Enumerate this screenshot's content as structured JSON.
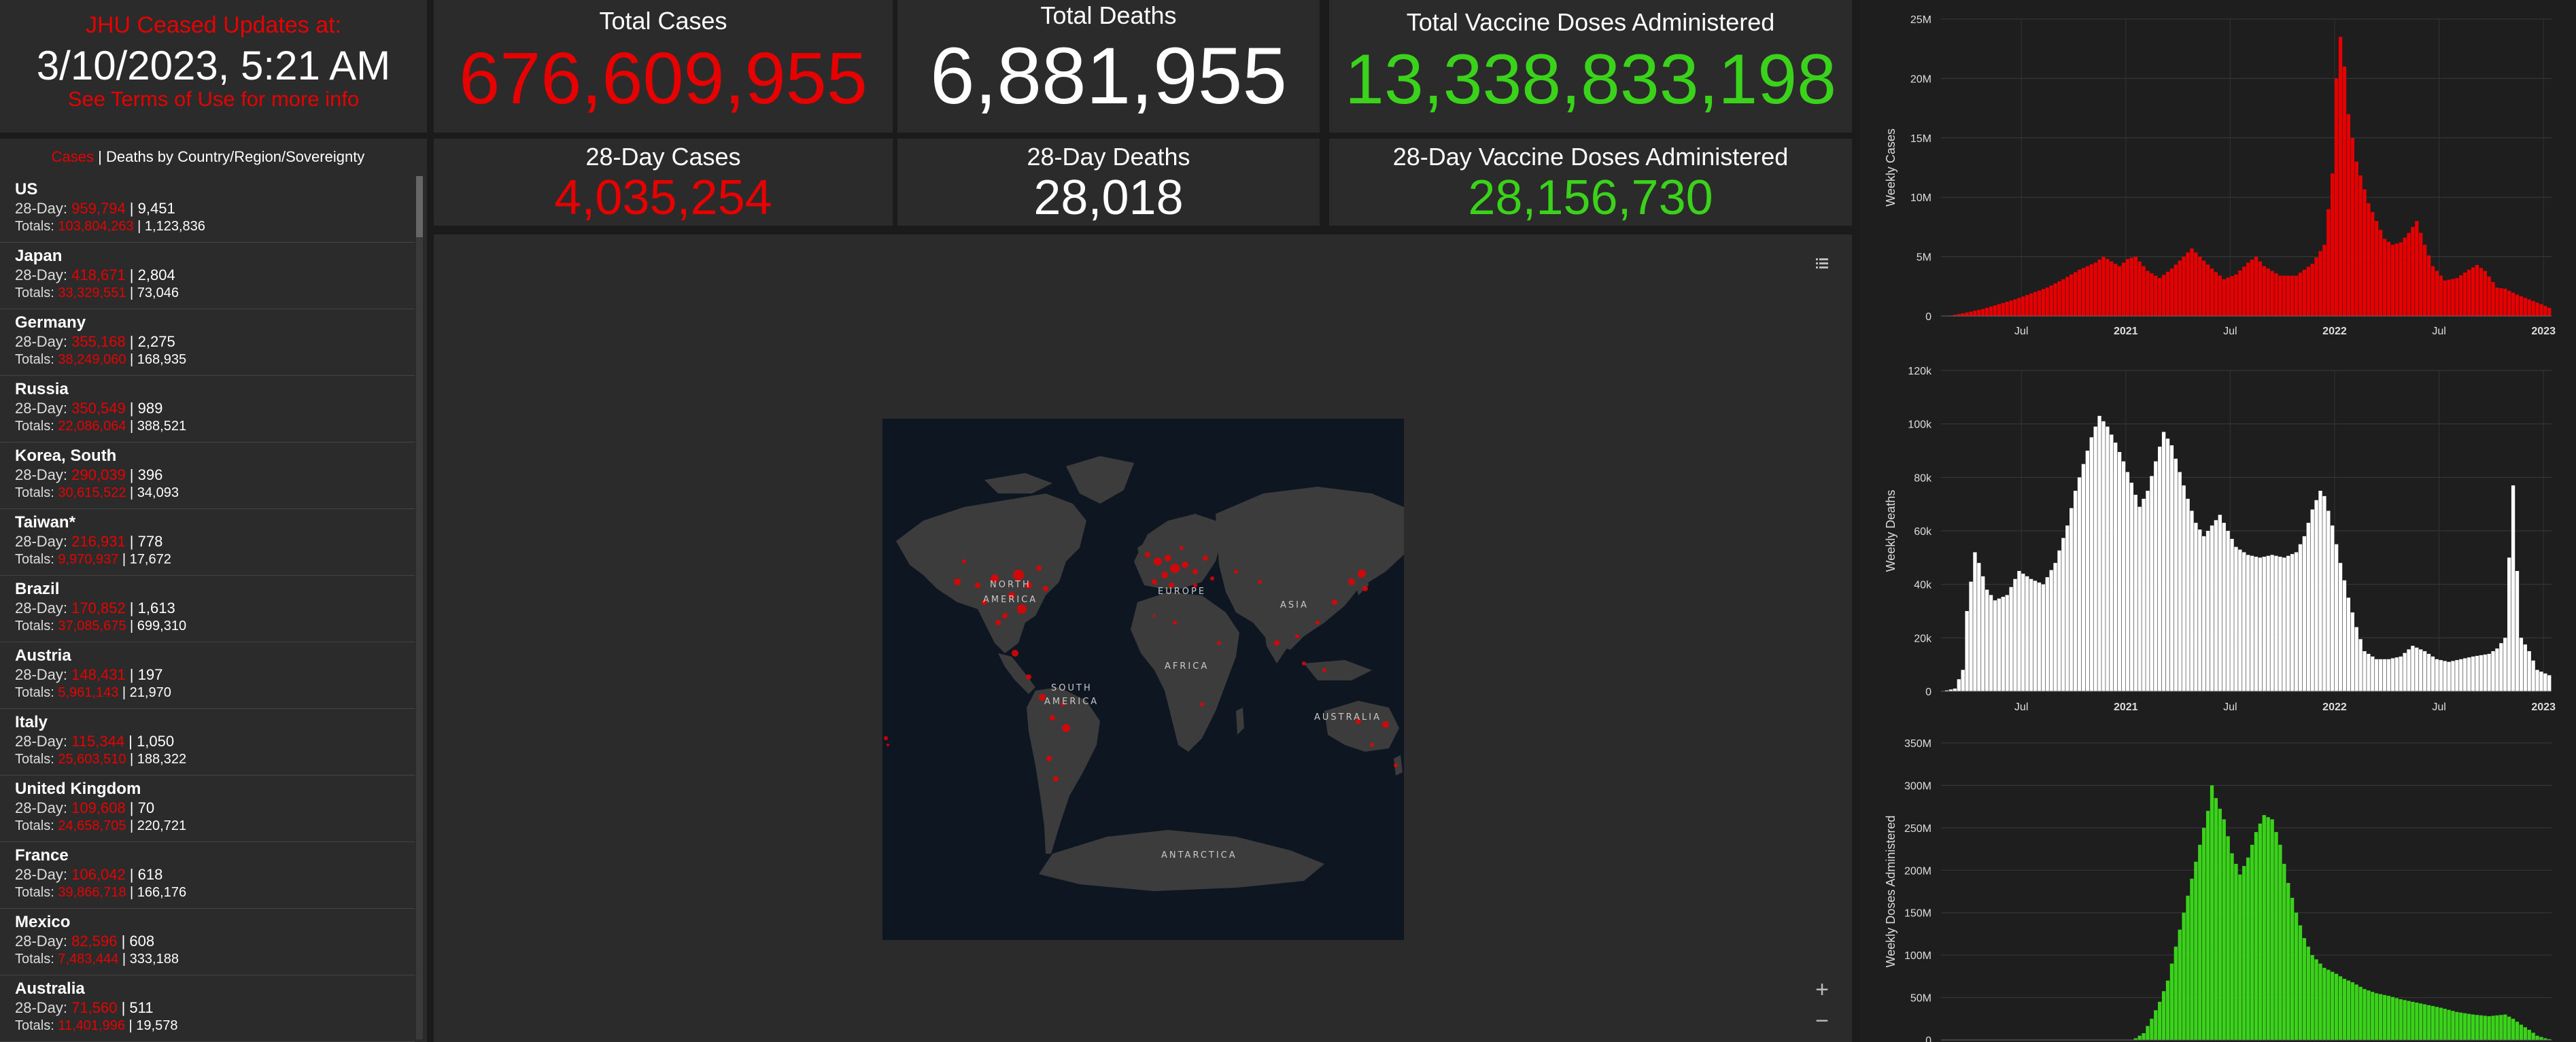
{
  "info": {
    "line1": "JHU Ceased Updates at:",
    "line2": "3/10/2023, 5:21 AM",
    "line3": "See Terms of Use for more info"
  },
  "stats": {
    "total_cases": {
      "title": "Total Cases",
      "value": "676,609,955"
    },
    "total_deaths": {
      "title": "Total Deaths",
      "value": "6,881,955"
    },
    "total_vaccine": {
      "title": "Total Vaccine Doses Administered",
      "value": "13,338,833,198"
    },
    "cases_28": {
      "title": "28-Day Cases",
      "value": "4,035,254"
    },
    "deaths_28": {
      "title": "28-Day Deaths",
      "value": "28,018"
    },
    "vaccine_28": {
      "title": "28-Day Vaccine Doses Administered",
      "value": "28,156,730"
    }
  },
  "list": {
    "header_cases": "Cases",
    "header_sep": " | ",
    "header_rest": "Deaths by Country/Region/Sovereignty",
    "prefix_28": "28-Day: ",
    "prefix_tot": "Totals: ",
    "bar": " | ",
    "rows": [
      {
        "country": "US",
        "c28": "959,794",
        "d28": "9,451",
        "ct": "103,804,263",
        "dt": "1,123,836"
      },
      {
        "country": "Japan",
        "c28": "418,671",
        "d28": "2,804",
        "ct": "33,329,551",
        "dt": "73,046"
      },
      {
        "country": "Germany",
        "c28": "355,168",
        "d28": "2,275",
        "ct": "38,249,060",
        "dt": "168,935"
      },
      {
        "country": "Russia",
        "c28": "350,549",
        "d28": "989",
        "ct": "22,086,064",
        "dt": "388,521"
      },
      {
        "country": "Korea, South",
        "c28": "290,039",
        "d28": "396",
        "ct": "30,615,522",
        "dt": "34,093"
      },
      {
        "country": "Taiwan*",
        "c28": "216,931",
        "d28": "778",
        "ct": "9,970,937",
        "dt": "17,672"
      },
      {
        "country": "Brazil",
        "c28": "170,852",
        "d28": "1,613",
        "ct": "37,085,675",
        "dt": "699,310"
      },
      {
        "country": "Austria",
        "c28": "148,431",
        "d28": "197",
        "ct": "5,961,143",
        "dt": "21,970"
      },
      {
        "country": "Italy",
        "c28": "115,344",
        "d28": "1,050",
        "ct": "25,603,510",
        "dt": "188,322"
      },
      {
        "country": "United Kingdom",
        "c28": "109,608",
        "d28": "70",
        "ct": "24,658,705",
        "dt": "220,721"
      },
      {
        "country": "France",
        "c28": "106,042",
        "d28": "618",
        "ct": "39,866,718",
        "dt": "166,176"
      },
      {
        "country": "Mexico",
        "c28": "82,596",
        "d28": "608",
        "ct": "7,483,444",
        "dt": "333,188"
      },
      {
        "country": "Australia",
        "c28": "71,560",
        "d28": "511",
        "ct": "11,401,996",
        "dt": "19,578"
      }
    ]
  },
  "map": {
    "labels": [
      "NORTH",
      "AMERICA",
      "EUROPE",
      "ASIA",
      "AFRICA",
      "SOUTH",
      "AMERICA",
      "AUSTRALIA",
      "ANTARCTICA"
    ]
  },
  "icons": {
    "legend": "list-icon",
    "zoom_in": "plus-icon",
    "zoom_out": "minus-icon",
    "zoom_in_glyph": "+",
    "zoom_out_glyph": "−"
  },
  "colors": {
    "cases": "#e60000",
    "deaths": "#ffffff",
    "vaccine": "#3ad21a",
    "panel": "#2b2b2b"
  },
  "chart_data": [
    {
      "type": "bar",
      "ylabel": "Weekly Cases",
      "ylim": [
        0,
        25000000
      ],
      "yticks": [
        "0",
        "5M",
        "10M",
        "15M",
        "20M",
        "25M"
      ],
      "ytick_values": [
        0,
        5000000,
        10000000,
        15000000,
        20000000,
        25000000
      ],
      "xticks": [
        "Jul",
        "2021",
        "Jul",
        "2022",
        "Jul",
        "2023"
      ],
      "xtick_weeks": [
        20,
        46,
        72,
        98,
        124,
        150
      ],
      "color": "#e60000",
      "keys": [
        [
          0,
          0
        ],
        [
          2,
          0.05
        ],
        [
          6,
          0.3
        ],
        [
          10,
          0.6
        ],
        [
          14,
          1.0
        ],
        [
          18,
          1.4
        ],
        [
          22,
          1.9
        ],
        [
          26,
          2.4
        ],
        [
          30,
          3.1
        ],
        [
          34,
          3.9
        ],
        [
          38,
          4.5
        ],
        [
          40,
          5.0
        ],
        [
          42,
          4.6
        ],
        [
          44,
          4.2
        ],
        [
          46,
          4.8
        ],
        [
          48,
          5.0
        ],
        [
          51,
          3.8
        ],
        [
          54,
          3.2
        ],
        [
          57,
          4.0
        ],
        [
          60,
          5.0
        ],
        [
          62,
          5.7
        ],
        [
          64,
          5.0
        ],
        [
          67,
          4.0
        ],
        [
          70,
          3.1
        ],
        [
          73,
          3.5
        ],
        [
          76,
          4.5
        ],
        [
          78,
          5.0
        ],
        [
          80,
          4.2
        ],
        [
          84,
          3.4
        ],
        [
          88,
          3.4
        ],
        [
          92,
          4.4
        ],
        [
          95,
          6.0
        ],
        [
          97,
          12
        ],
        [
          98,
          20
        ],
        [
          99,
          23.5
        ],
        [
          100,
          21
        ],
        [
          101,
          17
        ],
        [
          103,
          13
        ],
        [
          106,
          9.5
        ],
        [
          110,
          6.5
        ],
        [
          112,
          6.0
        ],
        [
          114,
          6.2
        ],
        [
          116,
          7.0
        ],
        [
          118,
          8.0
        ],
        [
          120,
          6.0
        ],
        [
          122,
          4.2
        ],
        [
          125,
          3.0
        ],
        [
          128,
          3.2
        ],
        [
          131,
          3.9
        ],
        [
          133,
          4.3
        ],
        [
          135,
          3.8
        ],
        [
          138,
          2.4
        ],
        [
          140,
          2.3
        ],
        [
          143,
          1.8
        ],
        [
          146,
          1.4
        ],
        [
          149,
          1.0
        ],
        [
          151,
          0.7
        ]
      ],
      "keys_unit": 1000000,
      "weeks": 152
    },
    {
      "type": "bar",
      "ylabel": "Weekly Deaths",
      "ylim": [
        0,
        120000
      ],
      "yticks": [
        "0",
        "20k",
        "40k",
        "60k",
        "80k",
        "100k",
        "120k"
      ],
      "ytick_values": [
        0,
        20000,
        40000,
        60000,
        80000,
        100000,
        120000
      ],
      "xticks": [
        "Jul",
        "2021",
        "Jul",
        "2022",
        "Jul",
        "2023"
      ],
      "xtick_weeks": [
        20,
        46,
        72,
        98,
        124,
        150
      ],
      "color": "#ffffff",
      "keys": [
        [
          0,
          0
        ],
        [
          3,
          1
        ],
        [
          5,
          8
        ],
        [
          6,
          30
        ],
        [
          8,
          52
        ],
        [
          9,
          48
        ],
        [
          11,
          38
        ],
        [
          13,
          34
        ],
        [
          16,
          36
        ],
        [
          19,
          45
        ],
        [
          22,
          42
        ],
        [
          25,
          40
        ],
        [
          28,
          48
        ],
        [
          31,
          62
        ],
        [
          33,
          75
        ],
        [
          35,
          85
        ],
        [
          37,
          95
        ],
        [
          39,
          103
        ],
        [
          41,
          99
        ],
        [
          43,
          93
        ],
        [
          45,
          86
        ],
        [
          47,
          78
        ],
        [
          49,
          69
        ],
        [
          51,
          75
        ],
        [
          53,
          86
        ],
        [
          55,
          97
        ],
        [
          57,
          92
        ],
        [
          59,
          82
        ],
        [
          61,
          72
        ],
        [
          63,
          63
        ],
        [
          65,
          58
        ],
        [
          67,
          62
        ],
        [
          69,
          66
        ],
        [
          71,
          60
        ],
        [
          73,
          54
        ],
        [
          76,
          51
        ],
        [
          79,
          50
        ],
        [
          82,
          51
        ],
        [
          85,
          50
        ],
        [
          88,
          52
        ],
        [
          90,
          58
        ],
        [
          92,
          68
        ],
        [
          94,
          75
        ],
        [
          95,
          73
        ],
        [
          97,
          62
        ],
        [
          99,
          48
        ],
        [
          101,
          35
        ],
        [
          103,
          24
        ],
        [
          105,
          15
        ],
        [
          108,
          12
        ],
        [
          111,
          12
        ],
        [
          114,
          13
        ],
        [
          117,
          17
        ],
        [
          120,
          15
        ],
        [
          123,
          12
        ],
        [
          126,
          11
        ],
        [
          129,
          12
        ],
        [
          132,
          13
        ],
        [
          136,
          14
        ],
        [
          138,
          16
        ],
        [
          140,
          20
        ],
        [
          141,
          50
        ],
        [
          142,
          77
        ],
        [
          143,
          45
        ],
        [
          144,
          20
        ],
        [
          146,
          15
        ],
        [
          148,
          8
        ],
        [
          151,
          6
        ]
      ],
      "keys_unit": 1000,
      "weeks": 152
    },
    {
      "type": "bar",
      "ylabel": "Weekly Doses Administered",
      "ylim": [
        0,
        350000000
      ],
      "yticks": [
        "0",
        "50M",
        "100M",
        "150M",
        "200M",
        "250M",
        "300M",
        "350M"
      ],
      "ytick_values": [
        0,
        50000000,
        100000000,
        150000000,
        200000000,
        250000000,
        300000000,
        350000000
      ],
      "xticks": [],
      "xtick_weeks": [],
      "color": "#3ad21a",
      "keys": [
        [
          0,
          0
        ],
        [
          47,
          0
        ],
        [
          48,
          2
        ],
        [
          50,
          8
        ],
        [
          52,
          25
        ],
        [
          54,
          45
        ],
        [
          56,
          70
        ],
        [
          58,
          110
        ],
        [
          60,
          150
        ],
        [
          62,
          190
        ],
        [
          64,
          230
        ],
        [
          66,
          270
        ],
        [
          67,
          300
        ],
        [
          68,
          285
        ],
        [
          70,
          260
        ],
        [
          72,
          220
        ],
        [
          74,
          195
        ],
        [
          76,
          215
        ],
        [
          78,
          245
        ],
        [
          80,
          265
        ],
        [
          82,
          260
        ],
        [
          84,
          230
        ],
        [
          86,
          185
        ],
        [
          88,
          150
        ],
        [
          90,
          120
        ],
        [
          92,
          100
        ],
        [
          95,
          85
        ],
        [
          98,
          78
        ],
        [
          100,
          72
        ],
        [
          102,
          68
        ],
        [
          105,
          60
        ],
        [
          108,
          55
        ],
        [
          111,
          52
        ],
        [
          114,
          48
        ],
        [
          117,
          45
        ],
        [
          120,
          42
        ],
        [
          124,
          38
        ],
        [
          128,
          33
        ],
        [
          132,
          30
        ],
        [
          136,
          28
        ],
        [
          140,
          30
        ],
        [
          142,
          25
        ],
        [
          144,
          18
        ],
        [
          146,
          12
        ],
        [
          148,
          5
        ],
        [
          150,
          2
        ],
        [
          151,
          1
        ]
      ],
      "keys_unit": 1000000,
      "weeks": 152
    }
  ]
}
